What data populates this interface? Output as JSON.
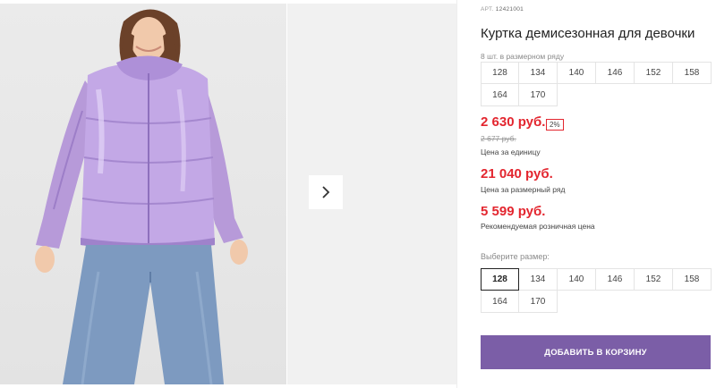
{
  "gallery": {
    "next_icon": "chevron-right-icon"
  },
  "product": {
    "art_label": "АРТ.",
    "art_number": "12421001",
    "title": "Куртка демисезонная для девочки",
    "lot_label": "8 шт. в размерном ряду",
    "lot_sizes": [
      "128",
      "134",
      "140",
      "146",
      "152",
      "158",
      "164",
      "170"
    ]
  },
  "pricing": {
    "unit_price": "2 630 руб.",
    "discount": "2%",
    "old_price": "2 677 руб.",
    "unit_caption": "Цена за единицу",
    "row_price": "21 040 руб.",
    "row_caption": "Цена за размерный ряд",
    "retail_price": "5 599 руб.",
    "retail_caption": "Рекомендуемая розничная цена",
    "price_color": "#e3262f"
  },
  "size_picker": {
    "label": "Выберите размер:",
    "sizes": [
      "128",
      "134",
      "140",
      "146",
      "152",
      "158",
      "164",
      "170"
    ],
    "selected": "128"
  },
  "cart": {
    "button_label": "ДОБАВИТЬ В КОРЗИНУ",
    "button_color": "#7b5ea7"
  }
}
